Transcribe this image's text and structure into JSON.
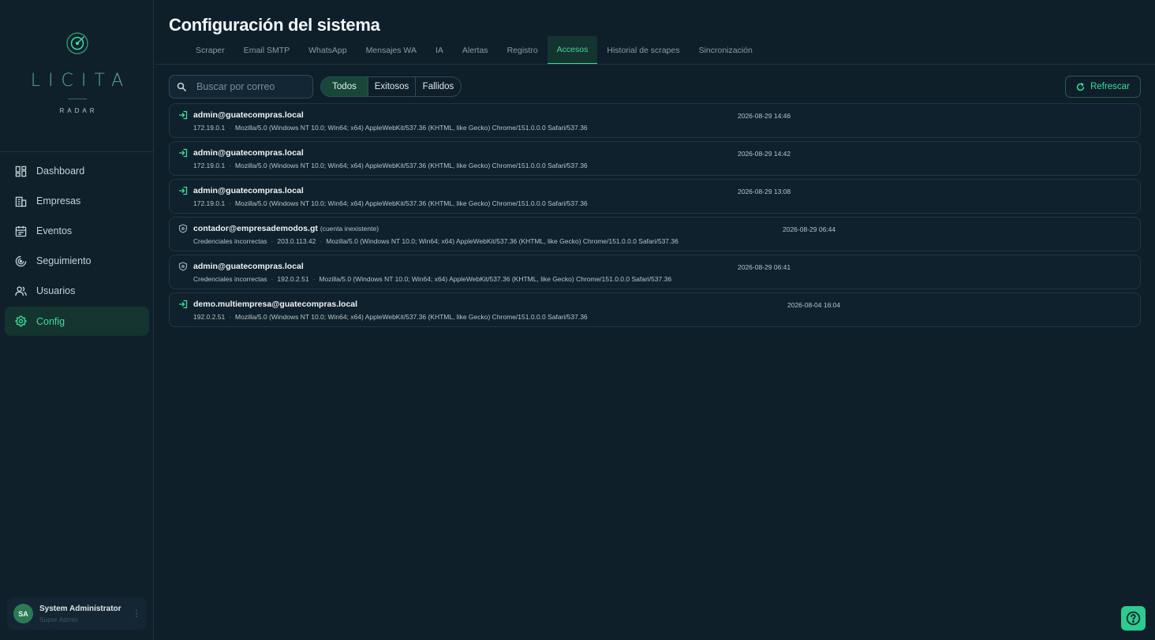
{
  "brand": {
    "name": "LICITA",
    "sub": "RADAR",
    "accent": "#3ddc9b"
  },
  "sidebar": {
    "items": [
      {
        "label": "Dashboard",
        "icon": "dashboard-icon"
      },
      {
        "label": "Empresas",
        "icon": "building-icon"
      },
      {
        "label": "Eventos",
        "icon": "calendar-icon"
      },
      {
        "label": "Seguimiento",
        "icon": "radar-icon"
      },
      {
        "label": "Usuarios",
        "icon": "users-icon"
      },
      {
        "label": "Config",
        "icon": "gear-icon",
        "active": true
      }
    ],
    "user": {
      "initials": "SA",
      "name": "System Administrator",
      "role": "Super Admin",
      "menu": "⋮"
    }
  },
  "page": {
    "title": "Configuración del sistema"
  },
  "tabs": [
    {
      "label": "Scraper"
    },
    {
      "label": "Email SMTP"
    },
    {
      "label": "WhatsApp"
    },
    {
      "label": "Mensajes WA"
    },
    {
      "label": "IA"
    },
    {
      "label": "Alertas"
    },
    {
      "label": "Registro"
    },
    {
      "label": "Accesos",
      "active": true
    },
    {
      "label": "Historial de scrapes"
    },
    {
      "label": "Sincronización"
    }
  ],
  "toolbar": {
    "search_placeholder": "Buscar por correo",
    "filters": [
      {
        "label": "Todos",
        "active": true
      },
      {
        "label": "Exitosos"
      },
      {
        "label": "Fallidos"
      }
    ],
    "refresh_label": "Refrescar"
  },
  "access_log": [
    {
      "status": "success",
      "icon": "login-icon",
      "email": "admin@guatecompras.local",
      "note": "",
      "reason": "",
      "ip": "172.19.0.1",
      "agent": "Mozilla/5.0 (Windows NT 10.0; Win64; x64) AppleWebKit/537.36 (KHTML, like Gecko) Chrome/151.0.0.0 Safari/537.36",
      "time": "2026-08-29 14:46"
    },
    {
      "status": "success",
      "icon": "login-icon",
      "email": "admin@guatecompras.local",
      "note": "",
      "reason": "",
      "ip": "172.19.0.1",
      "agent": "Mozilla/5.0 (Windows NT 10.0; Win64; x64) AppleWebKit/537.36 (KHTML, like Gecko) Chrome/151.0.0.0 Safari/537.36",
      "time": "2026-08-29 14:42"
    },
    {
      "status": "success",
      "icon": "login-icon",
      "email": "admin@guatecompras.local",
      "note": "",
      "reason": "",
      "ip": "172.19.0.1",
      "agent": "Mozilla/5.0 (Windows NT 10.0; Win64; x64) AppleWebKit/537.36 (KHTML, like Gecko) Chrome/151.0.0.0 Safari/537.36",
      "time": "2026-08-29 13:08"
    },
    {
      "status": "failed",
      "icon": "shield-icon",
      "email": "contador@empresademodos.gt",
      "note": "(cuenta inexistente)",
      "reason": "Credenciales incorrectas",
      "ip": "203.0.113.42",
      "agent": "Mozilla/5.0 (Windows NT 10.0; Win64; x64) AppleWebKit/537.36 (KHTML, like Gecko) Chrome/151.0.0.0 Safari/537.36",
      "time": "2026-08-29 06:44"
    },
    {
      "status": "failed",
      "icon": "shield-icon",
      "email": "admin@guatecompras.local",
      "note": "",
      "reason": "Credenciales incorrectas",
      "ip": "192.0.2.51",
      "agent": "Mozilla/5.0 (Windows NT 10.0; Win64; x64) AppleWebKit/537.36 (KHTML, like Gecko) Chrome/151.0.0.0 Safari/537.36",
      "time": "2026-08-29 06:41"
    },
    {
      "status": "success",
      "icon": "login-icon",
      "email": "demo.multiempresa@guatecompras.local",
      "note": "",
      "reason": "",
      "ip": "192.0.2.51",
      "agent": "Mozilla/5.0 (Windows NT 10.0; Win64; x64) AppleWebKit/537.36 (KHTML, like Gecko) Chrome/151.0.0.0 Safari/537.36",
      "time": "2026-08-04 16:04"
    }
  ],
  "help": {
    "icon": "help-icon"
  }
}
